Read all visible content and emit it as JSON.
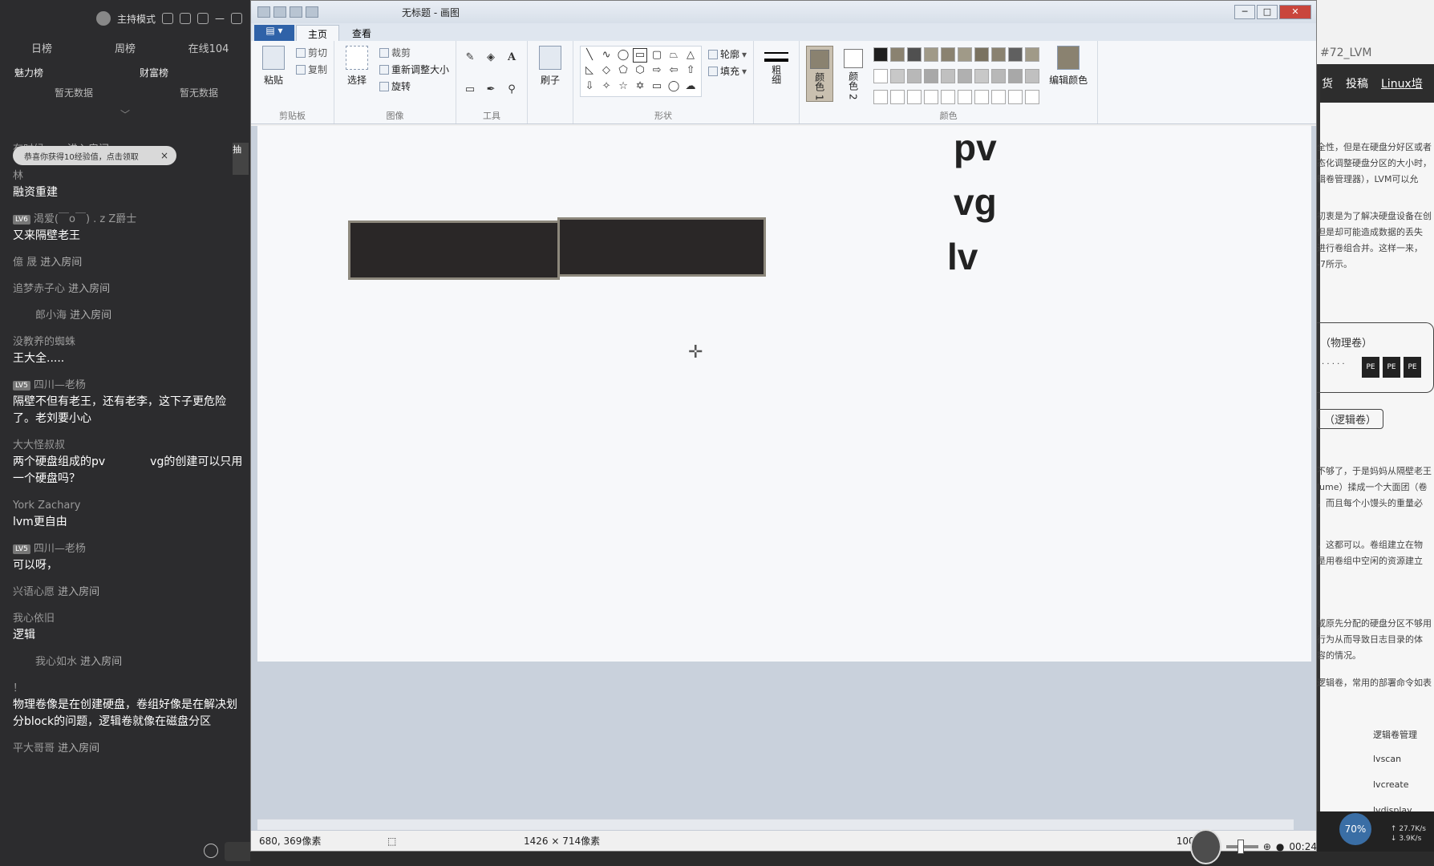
{
  "chat": {
    "host_mode": "主持模式",
    "tabs": [
      "日榜",
      "周榜",
      "在线104"
    ],
    "rank_charm": "魅力榜",
    "rank_wealth": "财富榜",
    "no_data": "暂无数据",
    "toast": "恭喜你获得10经验值，点击领取",
    "side_badge": "抽",
    "messages": [
      {
        "type": "enter",
        "name": "有时候......",
        "action": "进入房间"
      },
      {
        "type": "chat",
        "name": "林",
        "text": "融资重建"
      },
      {
        "type": "chat",
        "lv": "LV6",
        "name": "渴爱(￣o￣) . z Z爵士",
        "text": "又来隔壁老王"
      },
      {
        "type": "enter",
        "name": "億 晟",
        "action": "进入房间"
      },
      {
        "type": "enter",
        "name": "追梦赤子心",
        "action": "进入房间"
      },
      {
        "type": "enter",
        "name": "郎小海",
        "action": "进入房间",
        "indent": true
      },
      {
        "type": "chat",
        "name": "没教养的蜘蛛",
        "text": "王大全....."
      },
      {
        "type": "chat",
        "lv": "LV5",
        "name": "四川—老杨",
        "text": "隔壁不但有老王，还有老李，这下子更危险了。老刘要小心"
      },
      {
        "type": "chat",
        "name": "大大怪叔叔",
        "text": "两个硬盘组成的pv　　　　vg的创建可以只用一个硬盘吗？"
      },
      {
        "type": "chat",
        "name": "York Zachary",
        "text": "lvm更自由"
      },
      {
        "type": "chat",
        "lv": "LV5",
        "name": "四川—老杨",
        "text": "可以呀，"
      },
      {
        "type": "enter",
        "name": "兴语心愿",
        "action": "进入房间"
      },
      {
        "type": "chat",
        "name": "我心依旧",
        "text": "逻辑"
      },
      {
        "type": "enter",
        "name": "我心如水",
        "action": "进入房间",
        "indent": true
      },
      {
        "type": "chat",
        "name": "！",
        "text": "物理卷像是在创建硬盘，卷组好像是在解决划分block的问题，逻辑卷就像在磁盘分区"
      },
      {
        "type": "enter",
        "name": "平大哥哥",
        "action": "进入房间"
      }
    ]
  },
  "paint": {
    "title": "无标题 - 画图",
    "tabs": {
      "menu": "▤ ▾",
      "home": "主页",
      "view": "查看"
    },
    "clipboard": {
      "paste": "粘贴",
      "cut": "剪切",
      "copy": "复制",
      "group": "剪贴板"
    },
    "image": {
      "select": "选择",
      "crop": "裁剪",
      "resize": "重新调整大小",
      "rotate": "旋转",
      "group": "图像"
    },
    "tools": {
      "group": "工具"
    },
    "brush": "刷子",
    "shapes": {
      "outline": "轮廓",
      "fill": "填充",
      "group": "形状"
    },
    "size": "粗细",
    "color1": "颜色 1",
    "color2": "颜色 2",
    "edit_colors": "编辑颜色",
    "colors_group": "颜色",
    "palette": [
      "#1e1e1e",
      "#8a8270",
      "#505050",
      "#a09a88",
      "#8a8270",
      "#a09a88",
      "#7a7260",
      "#8a8270",
      "#606060",
      "#a09a88",
      "#ffffff",
      "#c8c8c8",
      "#b8b8b8",
      "#a8a8a8",
      "#c0c0c0",
      "#b0b0b0",
      "#c8c8c8",
      "#b8b8b8",
      "#a8a8a8",
      "#c0c0c0",
      "#ffffff",
      "#ffffff",
      "#ffffff",
      "#ffffff",
      "#ffffff",
      "#ffffff",
      "#ffffff",
      "#ffffff",
      "#ffffff",
      "#ffffff"
    ],
    "canvas_labels": {
      "pv": "pv",
      "vg": "vg",
      "lv": "lv"
    },
    "status": {
      "cursor": "680, 369像素",
      "size": "1426 × 714像素",
      "zoom": "100%"
    }
  },
  "doc": {
    "title": "#72_LVM",
    "nav": [
      "货",
      "投稿",
      "Linux培"
    ],
    "lines_top": [
      "全性，但是在硬盘分好区或者",
      "态化调整硬盘分区的大小时，",
      "辑卷管理器），LVM可以允"
    ],
    "lines_mid": [
      "初衷是为了解决硬盘设备在创",
      "但是却可能造成数据的丢失",
      "进行卷组合并。这样一来，",
      "-7所示。"
    ],
    "diagram_label": "（物理卷）",
    "pe": "PE",
    "lv_label": "（逻辑卷）",
    "lines_low": [
      "不够了，于是妈妈从隔壁老王",
      "lume）揉成一个大面团（卷",
      "，而且每个小馒头的重量必"
    ],
    "lines_low2": [
      "，这都可以。卷组建立在物",
      "是用卷组中空闲的资源建立"
    ],
    "lines_low3": [
      "或原先分配的硬盘分区不够用",
      "行为从而导致日志目录的体",
      "容的情况。"
    ],
    "line_cmd_intro": "逻辑卷，常用的部署命令如表",
    "commands": [
      "逻辑卷管理",
      "lvscan",
      "lvcreate",
      "lvdisplay"
    ],
    "speed_up": "↑ 27.7K/s",
    "speed_down": "↓ 3.9K/s",
    "battery": "70%"
  },
  "overlay": {
    "time": "00:24"
  }
}
